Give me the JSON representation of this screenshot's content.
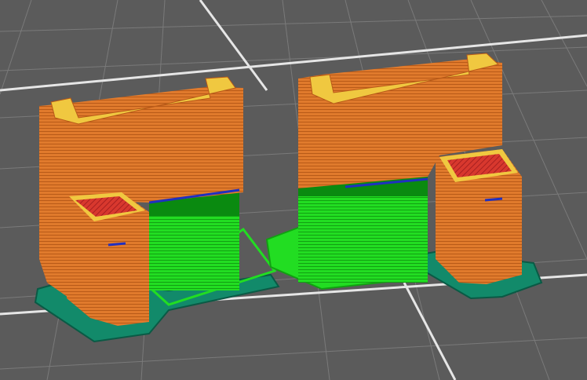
{
  "viewport": {
    "type": "slicer-3d-preview",
    "colors": {
      "background": "#5b5b5b",
      "grid_minor": "#7a7a7a",
      "grid_major": "#e6e6e6",
      "perimeter": "#e07a2c",
      "perimeter_dark": "#b85a18",
      "top_infill": "#d8382e",
      "top_edge": "#f0c840",
      "support": "#22dd22",
      "support_interface": "#0a8a10",
      "skirt": "#128a6a",
      "bridge": "#2030c0"
    }
  }
}
